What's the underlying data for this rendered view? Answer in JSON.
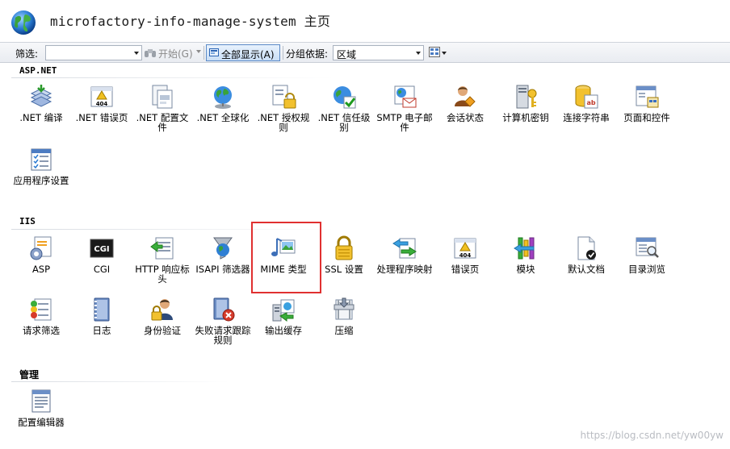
{
  "window": {
    "title": "microfactory-info-manage-system 主页"
  },
  "toolbar": {
    "filter_label": "筛选:",
    "filter_value": "",
    "start_label": "开始(G)",
    "showall_label": "全部显示(A)",
    "groupby_label": "分组依据:",
    "groupby_value": "区域"
  },
  "sections": [
    {
      "title": "ASP.NET",
      "items": [
        {
          "label": ".NET 编译",
          "icon": "net-compile-icon"
        },
        {
          "label": ".NET 错误页",
          "icon": "net-error-pages-icon"
        },
        {
          "label": ".NET 配置文件",
          "icon": "net-profile-icon"
        },
        {
          "label": ".NET 全球化",
          "icon": "net-globalization-icon"
        },
        {
          "label": ".NET 授权规则",
          "icon": "net-authorization-icon"
        },
        {
          "label": ".NET 信任级别",
          "icon": "net-trust-levels-icon"
        },
        {
          "label": "SMTP 电子邮件",
          "icon": "smtp-email-icon"
        },
        {
          "label": "会话状态",
          "icon": "session-state-icon"
        },
        {
          "label": "计算机密钥",
          "icon": "machine-key-icon"
        },
        {
          "label": "连接字符串",
          "icon": "connection-strings-icon"
        },
        {
          "label": "页面和控件",
          "icon": "pages-controls-icon"
        },
        {
          "label": "应用程序设置",
          "icon": "app-settings-icon"
        }
      ]
    },
    {
      "title": "IIS",
      "items": [
        {
          "label": "ASP",
          "icon": "asp-icon"
        },
        {
          "label": "CGI",
          "icon": "cgi-icon"
        },
        {
          "label": "HTTP 响应标头",
          "icon": "http-headers-icon"
        },
        {
          "label": "ISAPI 筛选器",
          "icon": "isapi-filters-icon"
        },
        {
          "label": "MIME 类型",
          "icon": "mime-types-icon"
        },
        {
          "label": "SSL 设置",
          "icon": "ssl-settings-icon"
        },
        {
          "label": "处理程序映射",
          "icon": "handler-mappings-icon"
        },
        {
          "label": "错误页",
          "icon": "error-pages-icon"
        },
        {
          "label": "模块",
          "icon": "modules-icon"
        },
        {
          "label": "默认文档",
          "icon": "default-document-icon"
        },
        {
          "label": "目录浏览",
          "icon": "directory-browsing-icon"
        },
        {
          "label": "请求筛选",
          "icon": "request-filtering-icon"
        },
        {
          "label": "日志",
          "icon": "logging-icon"
        },
        {
          "label": "身份验证",
          "icon": "authentication-icon"
        },
        {
          "label": "失败请求跟踪规则",
          "icon": "failed-request-tracing-icon"
        },
        {
          "label": "输出缓存",
          "icon": "output-caching-icon"
        },
        {
          "label": "压缩",
          "icon": "compression-icon"
        }
      ]
    },
    {
      "title": "管理",
      "items": [
        {
          "label": "配置编辑器",
          "icon": "configuration-editor-icon"
        }
      ]
    }
  ],
  "watermark": "https://blog.csdn.net/yw00yw",
  "colors": {
    "highlight_border": "#e03030",
    "toolbar_active": "#c9def6"
  }
}
